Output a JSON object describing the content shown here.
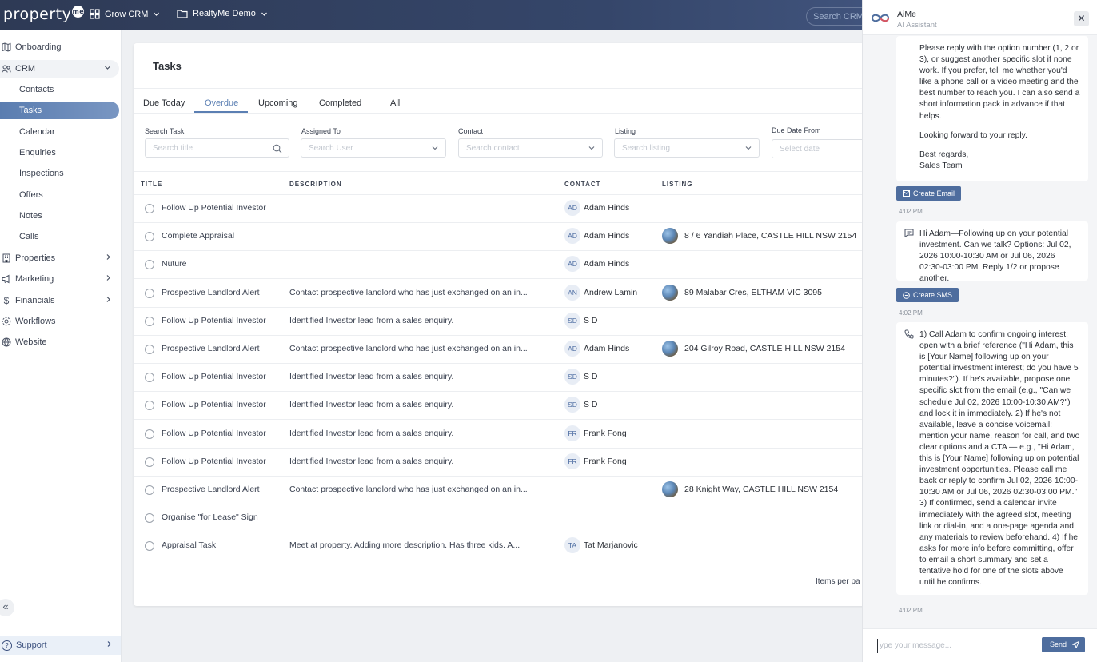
{
  "topbar": {
    "logo_text": "property",
    "logo_badge": "me",
    "app_menu": "Grow CRM",
    "workspace_menu": "RealtyMe Demo",
    "search_placeholder": "Search CRM..."
  },
  "sidebar": {
    "items": [
      {
        "label": "Onboarding",
        "icon": "map-icon"
      },
      {
        "label": "CRM",
        "icon": "users-icon"
      },
      {
        "label": "Properties",
        "icon": "building-icon"
      },
      {
        "label": "Marketing",
        "icon": "megaphone-icon"
      },
      {
        "label": "Financials",
        "icon": "dollar-icon"
      },
      {
        "label": "Workflows",
        "icon": "workflow-icon"
      },
      {
        "label": "Website",
        "icon": "globe-icon"
      }
    ],
    "crm_sub": [
      "Contacts",
      "Tasks",
      "Calendar",
      "Enquiries",
      "Inspections",
      "Offers",
      "Notes",
      "Calls"
    ],
    "active_sub": "Tasks",
    "support_label": "Support"
  },
  "tasks": {
    "title": "Tasks",
    "tabs": [
      "Due Today",
      "Overdue",
      "Upcoming",
      "Completed",
      "All"
    ],
    "active_tab": "Overdue",
    "filters": [
      {
        "label": "Search Task",
        "placeholder": "Search title"
      },
      {
        "label": "Assigned To",
        "placeholder": "Search User"
      },
      {
        "label": "Contact",
        "placeholder": "Search contact"
      },
      {
        "label": "Listing",
        "placeholder": "Search listing"
      },
      {
        "label": "Due Date From",
        "placeholder": "Select date"
      }
    ],
    "columns": [
      "TITLE",
      "DESCRIPTION",
      "CONTACT",
      "LISTING"
    ],
    "rows": [
      {
        "title": "Follow Up Potential Investor",
        "description": "",
        "initials": "AD",
        "contact": "Adam Hinds",
        "listing": ""
      },
      {
        "title": "Complete Appraisal",
        "description": "",
        "initials": "AD",
        "contact": "Adam Hinds",
        "listing": "8 / 6 Yandiah Place, CASTLE HILL NSW 2154"
      },
      {
        "title": "Nuture",
        "description": "",
        "initials": "AD",
        "contact": "Adam Hinds",
        "listing": ""
      },
      {
        "title": "Prospective Landlord Alert",
        "description": "Contact prospective landlord who has just exchanged on an in...",
        "initials": "AN",
        "contact": "Andrew Lamin",
        "listing": "89 Malabar Cres, ELTHAM VIC 3095"
      },
      {
        "title": "Follow Up Potential Investor",
        "description": "Identified Investor lead from a sales enquiry.",
        "initials": "SD",
        "contact": "S D",
        "listing": ""
      },
      {
        "title": "Prospective Landlord Alert",
        "description": "Contact prospective landlord who has just exchanged on an in...",
        "initials": "AD",
        "contact": "Adam Hinds",
        "listing": "204 Gilroy Road, CASTLE HILL NSW 2154"
      },
      {
        "title": "Follow Up Potential Investor",
        "description": "Identified Investor lead from a sales enquiry.",
        "initials": "SD",
        "contact": "S D",
        "listing": ""
      },
      {
        "title": "Follow Up Potential Investor",
        "description": "Identified Investor lead from a sales enquiry.",
        "initials": "SD",
        "contact": "S D",
        "listing": ""
      },
      {
        "title": "Follow Up Potential Investor",
        "description": "Identified Investor lead from a sales enquiry.",
        "initials": "FR",
        "contact": "Frank Fong",
        "listing": ""
      },
      {
        "title": "Follow Up Potential Investor",
        "description": "Identified Investor lead from a sales enquiry.",
        "initials": "FR",
        "contact": "Frank Fong",
        "listing": ""
      },
      {
        "title": "Prospective Landlord Alert",
        "description": "Contact prospective landlord who has just exchanged on an in...",
        "initials": "",
        "contact": "",
        "listing": "28 Knight Way, CASTLE HILL NSW 2154"
      },
      {
        "title": "Organise \"for Lease\" Sign",
        "description": "",
        "initials": "",
        "contact": "",
        "listing": ""
      },
      {
        "title": "Appraisal Task",
        "description": "Meet at property. Adding more description. Has three kids. A...",
        "initials": "TA",
        "contact": "Tat Marjanovic",
        "listing": ""
      }
    ],
    "items_per_page_label": "Items per pa"
  },
  "ai": {
    "title": "AiMe",
    "subtitle": "AI Assistant",
    "email_paragraphs": [
      "Please reply with the option number (1, 2 or 3), or suggest another specific slot if none work. If you prefer, tell me whether you'd like a phone call or a video meeting and the best number to reach you. I can also send a short information pack in advance if that helps.",
      "Looking forward to your reply.",
      "Best regards,\nSales Team"
    ],
    "create_email_label": "Create Email",
    "time1": "4:02 PM",
    "sms_text": "Hi Adam—Following up on your potential investment. Can we talk? Options: Jul 02, 2026 10:00-10:30 AM or Jul 06, 2026 02:30-03:00 PM. Reply 1/2 or propose another.",
    "create_sms_label": "Create SMS",
    "time2": "4:02 PM",
    "call_text": "1) Call Adam to confirm ongoing interest: open with a brief reference (\"Hi Adam, this is [Your Name] following up on your potential investment interest; do you have 5 minutes?\"). If he's available, propose one specific slot from the email (e.g., \"Can we schedule Jul 02, 2026 10:00-10:30 AM?\") and lock it in immediately. 2) If he's not available, leave a concise voicemail: mention your name, reason for call, and two clear options and a CTA — e.g., \"Hi Adam, this is [Your Name] following up on potential investment opportunities. Please call me back or reply to confirm Jul 02, 2026 10:00-10:30 AM or Jul 06, 2026 02:30-03:00 PM.\" 3) If confirmed, send a calendar invite immediately with the agreed slot, meeting link or dial-in, and a one-page agenda and any materials to review beforehand. 4) If he asks for more info before committing, offer to email a short summary and set a tentative hold for one of the slots above until he confirms.",
    "time3": "4:02 PM",
    "input_placeholder": "ype your message...",
    "send_label": "Send"
  }
}
